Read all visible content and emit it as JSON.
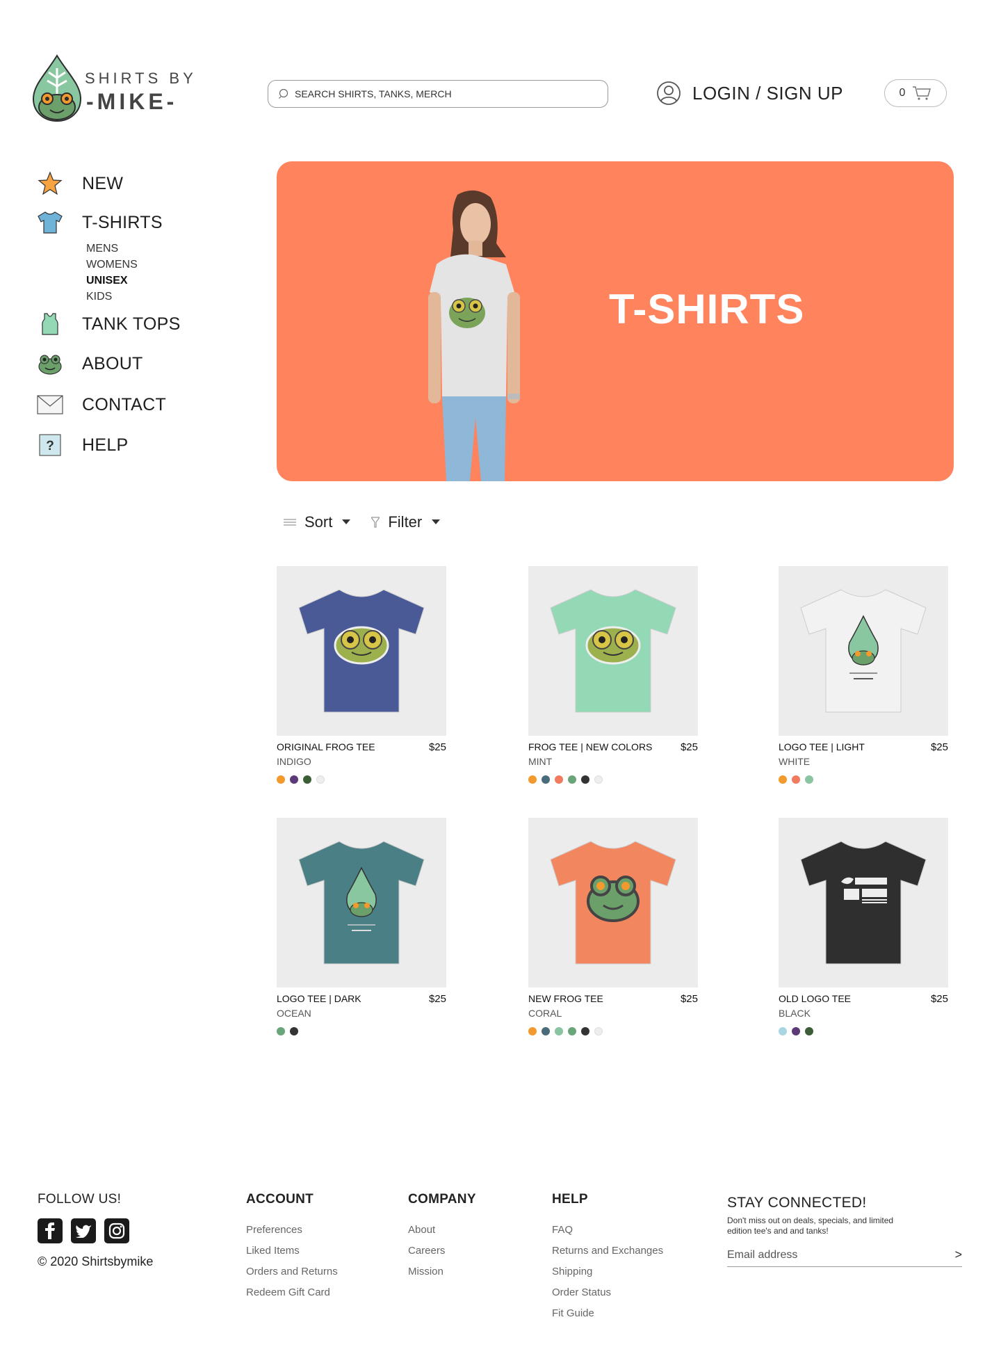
{
  "brand": {
    "top_line": "SHIRTS BY",
    "bottom_line": "-MIKE-",
    "colors": {
      "leaf": "#88c7a0",
      "frog": "#6ba06b",
      "accent": "#ff835c"
    }
  },
  "header": {
    "search_placeholder": "SEARCH SHIRTS, TANKS, MERCH",
    "login_label": "LOGIN / SIGN UP",
    "cart_count": "0"
  },
  "sidebar": {
    "items": [
      {
        "label": "NEW",
        "icon": "star-icon"
      },
      {
        "label": "T-SHIRTS",
        "icon": "tshirt-icon"
      },
      {
        "label": "TANK TOPS",
        "icon": "tank-top-icon"
      },
      {
        "label": "ABOUT",
        "icon": "frog-icon"
      },
      {
        "label": "CONTACT",
        "icon": "envelope-icon"
      },
      {
        "label": "HELP",
        "icon": "question-icon"
      }
    ],
    "subitems": [
      "MENS",
      "WOMENS",
      "UNISEX",
      "KIDS"
    ],
    "active_subitem": "UNISEX"
  },
  "hero": {
    "title": "T-SHIRTS",
    "background": "#ff835c"
  },
  "toolbar": {
    "sort_label": "Sort",
    "filter_label": "Filter"
  },
  "products": [
    {
      "name": "ORIGINAL FROG TEE",
      "price": "$25",
      "color": "INDIGO",
      "shirt": "#4a5a97",
      "swatches": [
        "#f29a2e",
        "#5b3a77",
        "#3c5e36",
        "#eeeeee"
      ]
    },
    {
      "name": "FROG TEE | NEW COLORS",
      "price": "$25",
      "color": "MINT",
      "shirt": "#93d9b6",
      "swatches": [
        "#f29a2e",
        "#4a6c7a",
        "#f27b5f",
        "#6aa57a",
        "#333333",
        "#eeeeee"
      ]
    },
    {
      "name": "LOGO TEE | LIGHT",
      "price": "$25",
      "color": "WHITE",
      "shirt": "#f2f2f2",
      "swatches": [
        "#f29a2e",
        "#f27b5f",
        "#8bc4a0"
      ]
    },
    {
      "name": "LOGO TEE | DARK",
      "price": "$25",
      "color": "OCEAN",
      "shirt": "#4b7f86",
      "swatches": [
        "#6aa57a",
        "#333333"
      ]
    },
    {
      "name": "NEW FROG TEE",
      "price": "$25",
      "color": "CORAL",
      "shirt": "#f2865f",
      "swatches": [
        "#f29a2e",
        "#4a6c7a",
        "#8bc4a0",
        "#6aa57a",
        "#333333",
        "#eeeeee"
      ]
    },
    {
      "name": "OLD LOGO TEE",
      "price": "$25",
      "color": "BLACK",
      "shirt": "#2f2f2f",
      "swatches": [
        "#a8d6e3",
        "#5b3a77",
        "#3c5e36"
      ]
    }
  ],
  "footer": {
    "follow": {
      "heading": "FOLLOW US!",
      "copyright": "© 2020 Shirtsbymike",
      "socials": [
        "facebook-icon",
        "twitter-icon",
        "instagram-icon"
      ]
    },
    "account": {
      "heading": "ACCOUNT",
      "links": [
        "Preferences",
        "Liked Items",
        "Orders and Returns",
        "Redeem Gift Card"
      ]
    },
    "company": {
      "heading": "COMPANY",
      "links": [
        "About",
        "Careers",
        "Mission"
      ]
    },
    "help": {
      "heading": "HELP",
      "links": [
        "FAQ",
        "Returns and Exchanges",
        "Shipping",
        "Order Status",
        "Fit Guide"
      ]
    },
    "stay": {
      "heading": "STAY CONNECTED!",
      "subtext": "Don't miss out on deals, specials, and limited edition tee's and and tanks!",
      "email_placeholder": "Email address"
    }
  }
}
